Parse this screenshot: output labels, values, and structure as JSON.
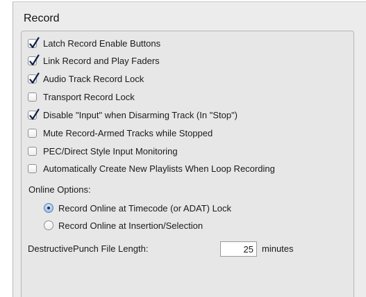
{
  "group": {
    "title": "Record"
  },
  "options": [
    {
      "label": "Latch Record Enable Buttons",
      "checked": true
    },
    {
      "label": "Link Record and Play Faders",
      "checked": true
    },
    {
      "label": "Audio Track Record Lock",
      "checked": true
    },
    {
      "label": "Transport Record Lock",
      "checked": false
    },
    {
      "label": "Disable \"Input\" when Disarming Track (In \"Stop\")",
      "checked": true
    },
    {
      "label": "Mute Record-Armed Tracks while Stopped",
      "checked": false
    },
    {
      "label": "PEC/Direct Style Input Monitoring",
      "checked": false
    },
    {
      "label": "Automatically Create New Playlists When Loop Recording",
      "checked": false
    }
  ],
  "online_options": {
    "label": "Online Options:",
    "choices": [
      {
        "label": "Record Online at Timecode (or ADAT) Lock",
        "selected": true
      },
      {
        "label": "Record Online at Insertion/Selection",
        "selected": false
      }
    ]
  },
  "destructive_punch": {
    "label": "DestructivePunch File Length:",
    "value": "25",
    "unit": "minutes"
  },
  "colors": {
    "panel": "#ececec",
    "group_box": "#e7e7e7",
    "check_mark": "#0b1f4a",
    "radio_selected": "#8fb3e2"
  }
}
